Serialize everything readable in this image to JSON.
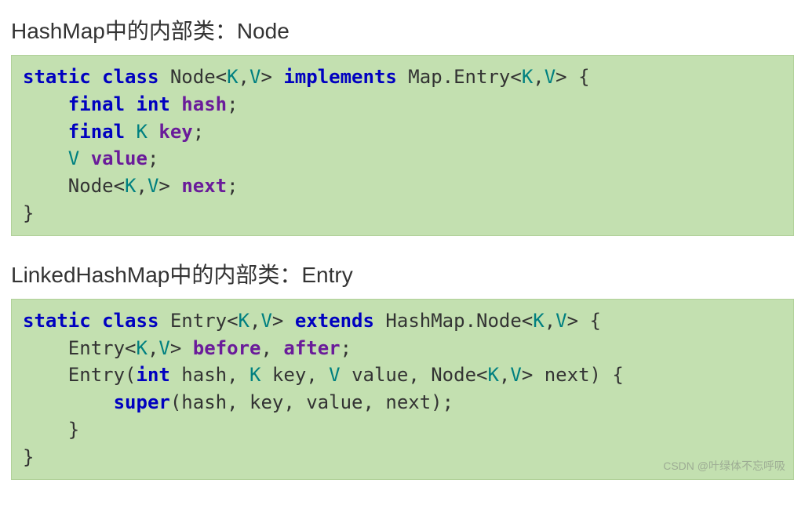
{
  "section1": {
    "heading": "HashMap中的内部类：Node",
    "code": {
      "l1": {
        "s1": "static class",
        "s2": " Node<",
        "s3": "K",
        "s4": ",",
        "s5": "V",
        "s6": "> ",
        "s7": "implements",
        "s8": " Map.Entry<",
        "s9": "K",
        "s10": ",",
        "s11": "V",
        "s12": "> {"
      },
      "l2": {
        "s1": "    ",
        "s2": "final int",
        "s3": " ",
        "s4": "hash",
        "s5": ";"
      },
      "l3": {
        "s1": "    ",
        "s2": "final",
        "s3": " ",
        "s4": "K",
        "s5": " ",
        "s6": "key",
        "s7": ";"
      },
      "l4": {
        "s1": "    ",
        "s2": "V",
        "s3": " ",
        "s4": "value",
        "s5": ";"
      },
      "l5": {
        "s1": "    Node<",
        "s2": "K",
        "s3": ",",
        "s4": "V",
        "s5": "> ",
        "s6": "next",
        "s7": ";"
      },
      "l6": {
        "s1": "}"
      }
    }
  },
  "section2": {
    "heading": "LinkedHashMap中的内部类：Entry",
    "code": {
      "l1": {
        "s1": "static class",
        "s2": " Entry<",
        "s3": "K",
        "s4": ",",
        "s5": "V",
        "s6": "> ",
        "s7": "extends",
        "s8": " HashMap.Node<",
        "s9": "K",
        "s10": ",",
        "s11": "V",
        "s12": "> {"
      },
      "l2": {
        "s1": "    Entry<",
        "s2": "K",
        "s3": ",",
        "s4": "V",
        "s5": "> ",
        "s6": "before",
        "s7": ", ",
        "s8": "after",
        "s9": ";"
      },
      "l3": {
        "s1": "    Entry(",
        "s2": "int",
        "s3": " hash, ",
        "s4": "K",
        "s5": " key, ",
        "s6": "V",
        "s7": " value, Node<",
        "s8": "K",
        "s9": ",",
        "s10": "V",
        "s11": "> next) {"
      },
      "l4": {
        "s1": "        ",
        "s2": "super",
        "s3": "(hash, key, value, next);"
      },
      "l5": {
        "s1": "    }"
      },
      "l6": {
        "s1": "}"
      }
    }
  },
  "watermark": "CSDN @叶绿体不忘呼吸"
}
